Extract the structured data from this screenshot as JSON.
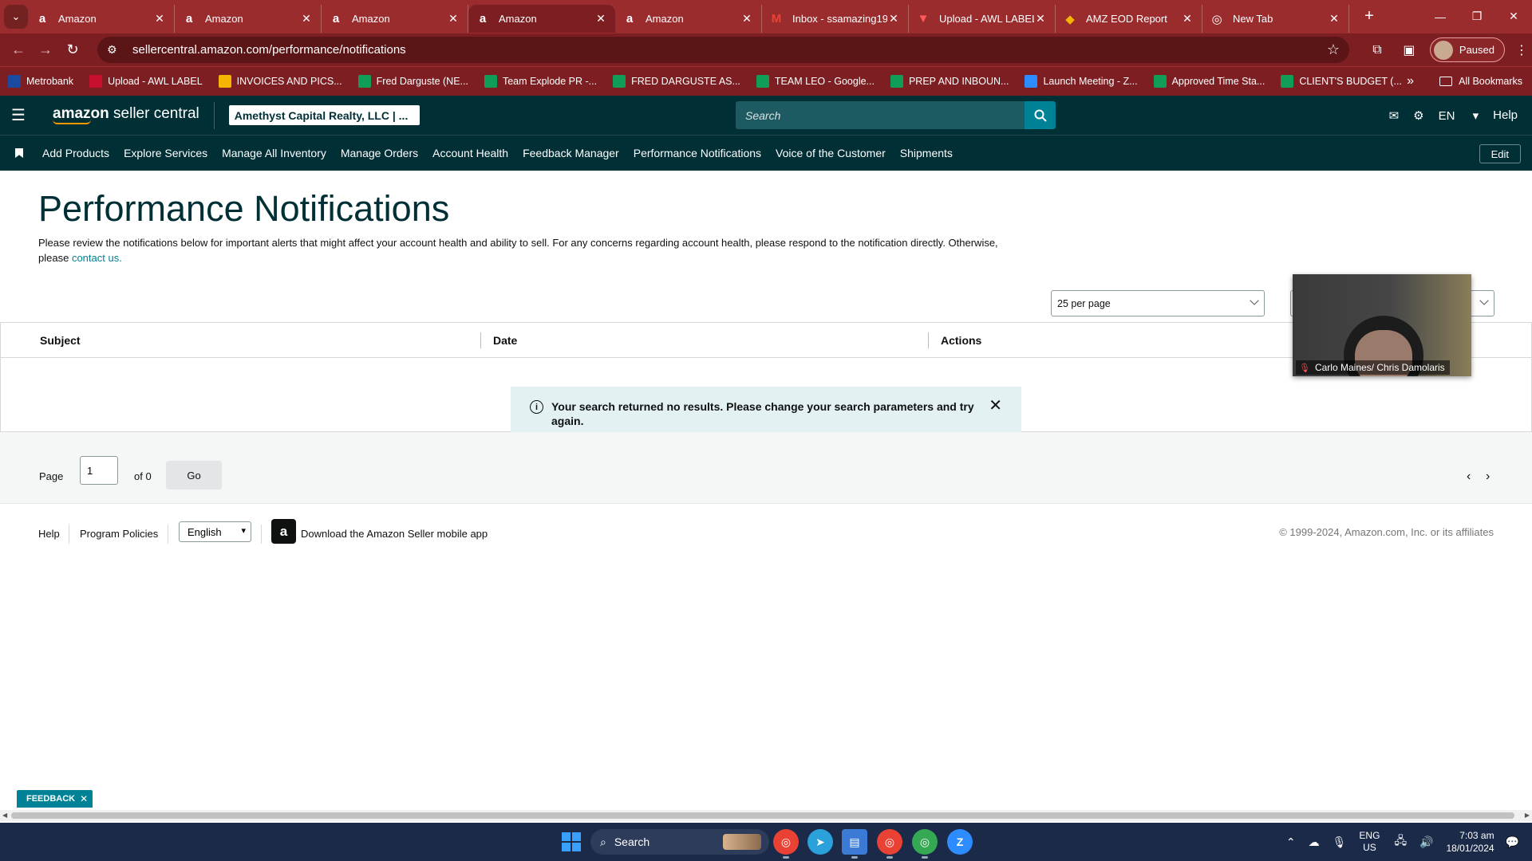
{
  "browser": {
    "tabs": [
      {
        "title": "Amazon",
        "icon": "amazon-icon",
        "active": false
      },
      {
        "title": "Amazon",
        "icon": "amazon-icon",
        "active": false
      },
      {
        "title": "Amazon",
        "icon": "amazon-icon",
        "active": false
      },
      {
        "title": "Amazon",
        "icon": "amazon-icon",
        "active": true
      },
      {
        "title": "Amazon",
        "icon": "amazon-icon",
        "active": false
      },
      {
        "title": "Inbox - ssamazing19",
        "icon": "gmail-icon",
        "active": false
      },
      {
        "title": "Upload - AWL LABEL",
        "icon": "upload-icon",
        "active": false
      },
      {
        "title": "AMZ EOD Report",
        "icon": "report-icon",
        "active": false
      },
      {
        "title": "New Tab",
        "icon": "chrome-icon",
        "active": false
      }
    ],
    "url": "sellercentral.amazon.com/performance/notifications",
    "profile_label": "Paused",
    "bookmarks": [
      {
        "label": "Metrobank",
        "color": "#1a4ba0"
      },
      {
        "label": "Upload - AWL LABEL",
        "color": "#c8102e"
      },
      {
        "label": "INVOICES AND PICS...",
        "color": "#f4b400"
      },
      {
        "label": "Fred Darguste (NE...",
        "color": "#0f9d58"
      },
      {
        "label": "Team Explode PR -...",
        "color": "#0f9d58"
      },
      {
        "label": "FRED DARGUSTE AS...",
        "color": "#0f9d58"
      },
      {
        "label": "TEAM LEO - Google...",
        "color": "#0f9d58"
      },
      {
        "label": "PREP AND INBOUN...",
        "color": "#0f9d58"
      },
      {
        "label": "Launch Meeting - Z...",
        "color": "#2d8cff"
      },
      {
        "label": "Approved Time Sta...",
        "color": "#0f9d58"
      },
      {
        "label": "CLIENT'S BUDGET (...",
        "color": "#0f9d58"
      }
    ],
    "all_bookmarks": "All Bookmarks"
  },
  "header": {
    "logo_bold": "amazon",
    "logo_rest": " seller central",
    "account": "Amethyst Capital Realty, LLC | ...",
    "search_placeholder": "Search",
    "lang": "EN",
    "help": "Help"
  },
  "nav": {
    "items": [
      "Add Products",
      "Explore Services",
      "Manage All Inventory",
      "Manage Orders",
      "Account Health",
      "Feedback Manager",
      "Performance Notifications",
      "Voice of the Customer",
      "Shipments"
    ],
    "edit": "Edit"
  },
  "page": {
    "title": "Performance Notifications",
    "description": "Please review the notifications below for important alerts that might affect your account health and ability to sell. For any concerns regarding account health, please respond to the notification directly. Otherwise, please",
    "contact_link": "contact us.",
    "per_page": "25 per page",
    "columns": [
      "Subject",
      "Date",
      "Actions"
    ],
    "empty_message": "Your search returned no results. Please change your search parameters and try again."
  },
  "pager": {
    "page_label": "Page",
    "page_value": "1",
    "of_label": "of 0",
    "go_label": "Go"
  },
  "footer": {
    "help": "Help",
    "policies": "Program Policies",
    "language": "English",
    "download": "Download the Amazon Seller mobile app",
    "copyright": "© 1999-2024, Amazon.com, Inc. or its affiliates"
  },
  "video_call": {
    "participant": "Carlo Maines/ Chris Damolaris"
  },
  "feedback": "FEEDBACK",
  "taskbar": {
    "search": "Search",
    "lang_top": "ENG",
    "lang_bottom": "US",
    "time": "7:03 am",
    "date": "18/01/2024"
  }
}
